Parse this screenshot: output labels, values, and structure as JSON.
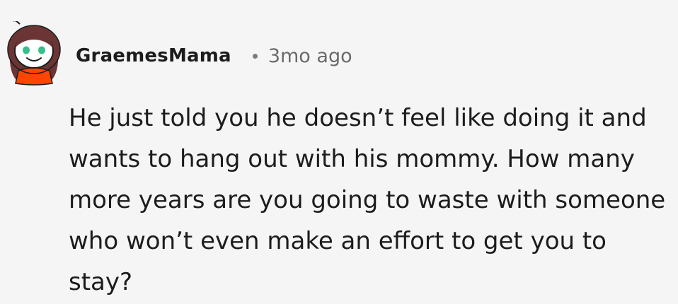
{
  "comment": {
    "username": "GraemesMama",
    "timestamp": "3mo ago",
    "body": "He just told you he doesn’t feel like doing it and wants to hang out with his mommy. How many more years are you going to waste with someone who won’t even make an effort to get you to stay?"
  },
  "colors": {
    "background": "#f5f5f5",
    "text": "#1c1c1c",
    "meta": "#6a6a6a",
    "avatar_shirt": "#ff4500",
    "avatar_hair": "#6b3535",
    "avatar_eyes": "#33c08a"
  },
  "icons": {
    "avatar": "snoo-avatar-icon"
  }
}
